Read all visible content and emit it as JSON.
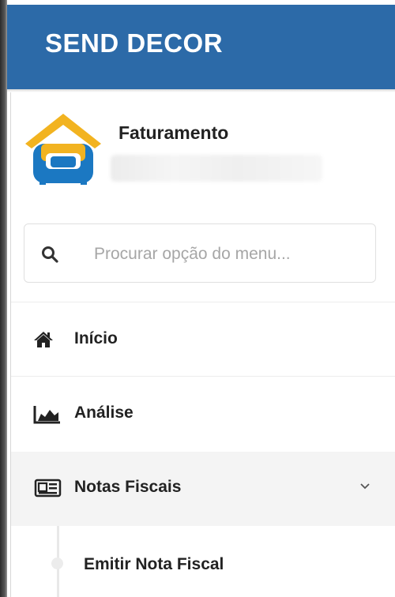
{
  "header": {
    "brand": "SEND DECOR",
    "color": "#2c6aa8"
  },
  "profile": {
    "title": "Faturamento",
    "subtitle_redacted": true,
    "avatar_icon": "sofa-house-logo"
  },
  "search": {
    "placeholder": "Procurar opção do menu...",
    "value": "",
    "icon": "search-icon"
  },
  "menu": {
    "items": [
      {
        "label": "Início",
        "icon": "home-icon",
        "active": false
      },
      {
        "label": "Análise",
        "icon": "area-chart-icon",
        "active": false
      },
      {
        "label": "Notas Fiscais",
        "icon": "newspaper-icon",
        "active": true,
        "expanded": true,
        "children": [
          {
            "label": "Emitir Nota Fiscal"
          }
        ]
      }
    ]
  }
}
